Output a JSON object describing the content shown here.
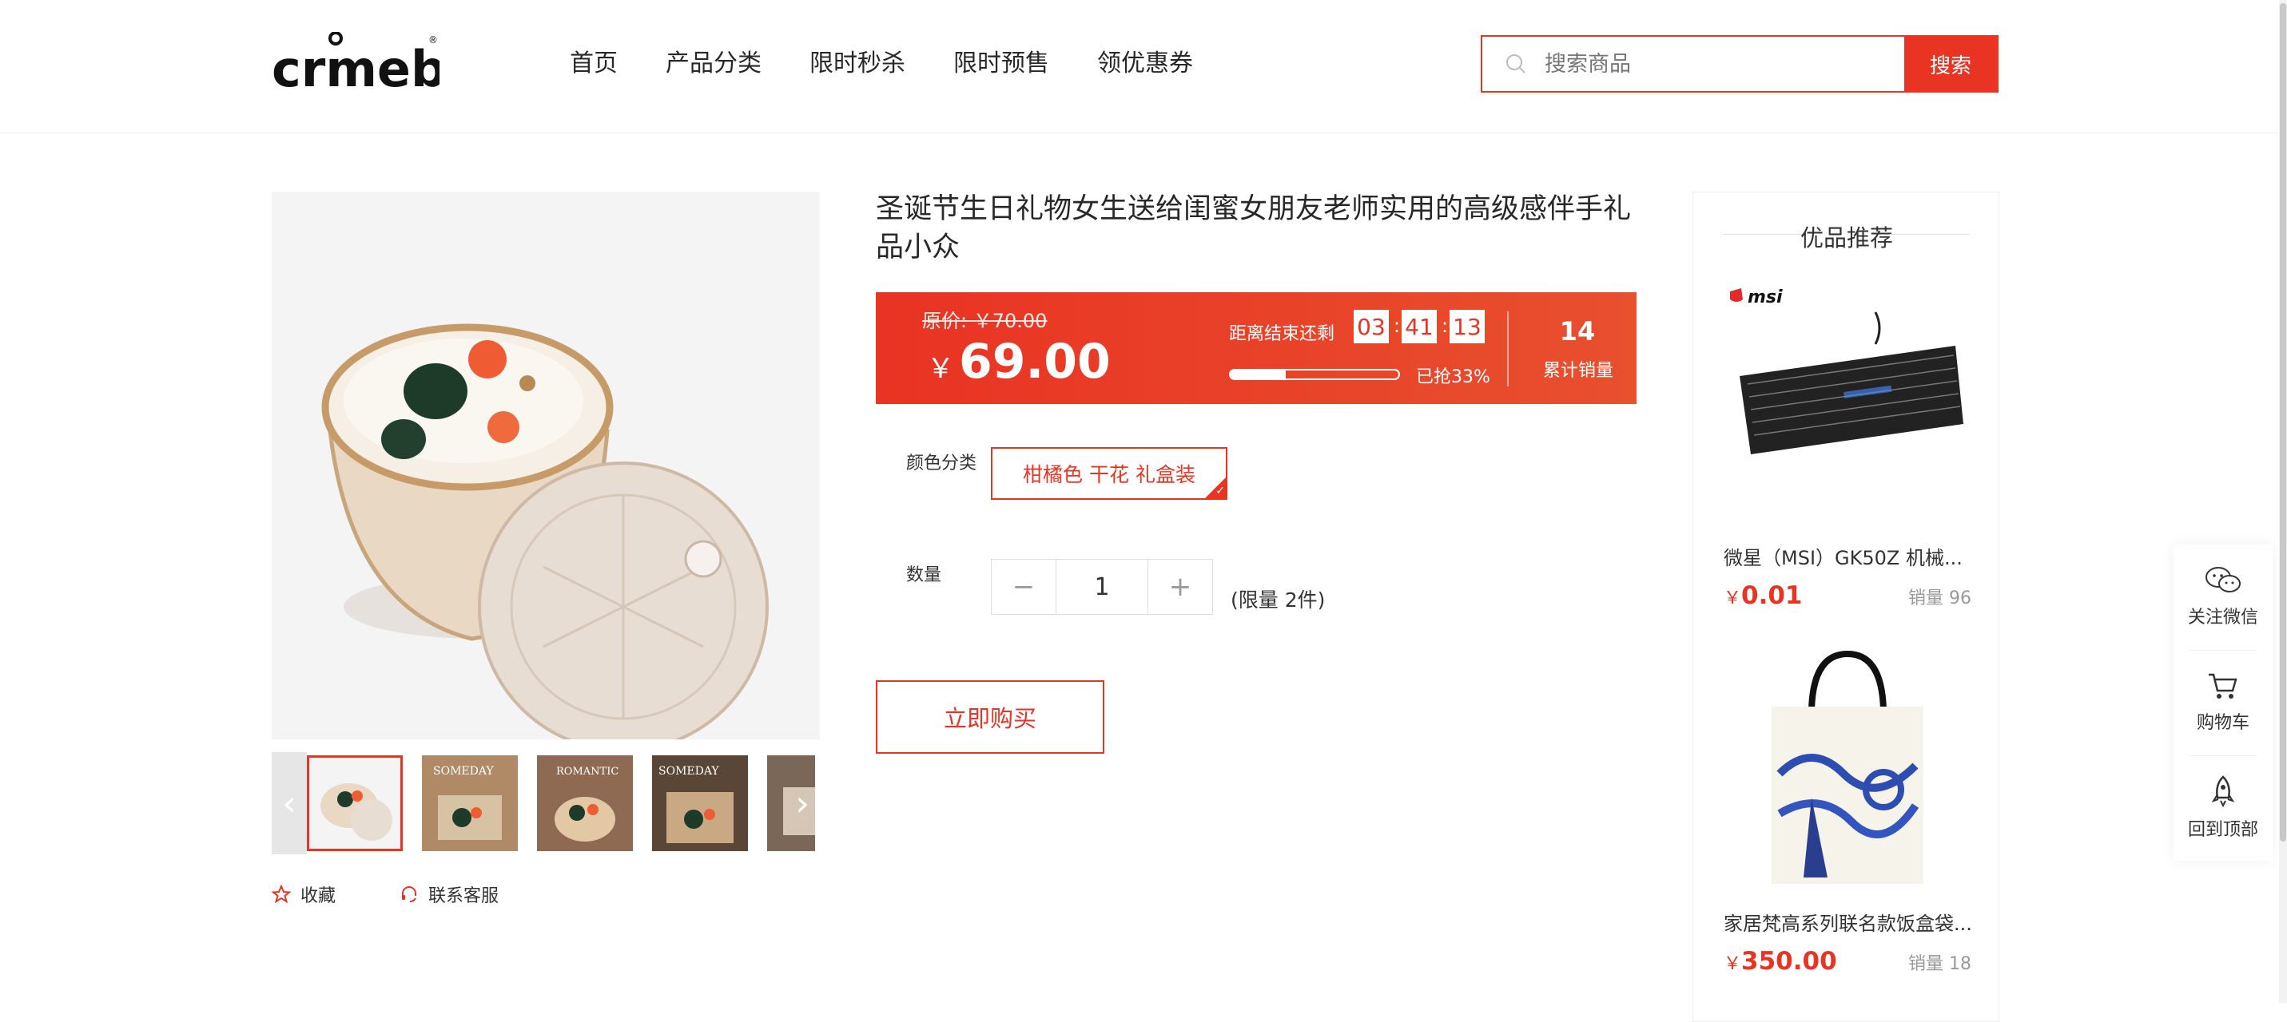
{
  "header": {
    "logo_text": "crmeb",
    "nav": [
      "首页",
      "产品分类",
      "限时秒杀",
      "限时预售",
      "领优惠券"
    ],
    "search": {
      "placeholder": "搜索商品",
      "button": "搜索"
    }
  },
  "product": {
    "title": "圣诞节生日礼物女生送给闺蜜女朋友老师实用的高级感伴手礼品小众",
    "original_price": "原价: ￥70.00",
    "currency": "￥",
    "price": "69.00",
    "countdown_label": "距离结束还剩",
    "countdown": {
      "h": "03",
      "m": "41",
      "s": "13"
    },
    "progress_percent": 33,
    "progress_label": "已抢33%",
    "sales_count": "14",
    "sales_label": "累计销量",
    "color_label": "颜色分类",
    "sku_selected": "柑橘色 干花 礼盒装",
    "quantity_label": "数量",
    "quantity": "1",
    "quantity_limit": "(限量 2件)",
    "buy_button": "立即购买",
    "actions": {
      "favorite": "收藏",
      "service": "联系客服"
    },
    "thumb_texts": [
      "",
      "SOMEDAY",
      "ROMANTIC",
      "SOMEDAY",
      ""
    ]
  },
  "recommend": {
    "title": "优品推荐",
    "items": [
      {
        "brand": "msi",
        "name": "微星（MSI）GK50Z 机械...",
        "currency": "￥",
        "price": "0.01",
        "sales": "销量 96"
      },
      {
        "name": "家居梵高系列联名款饭盒袋...",
        "currency": "￥",
        "price": "350.00",
        "sales": "销量 18"
      }
    ]
  },
  "side_tools": [
    "关注微信",
    "购物车",
    "回到顶部"
  ],
  "colors": {
    "accent": "#e93323"
  }
}
